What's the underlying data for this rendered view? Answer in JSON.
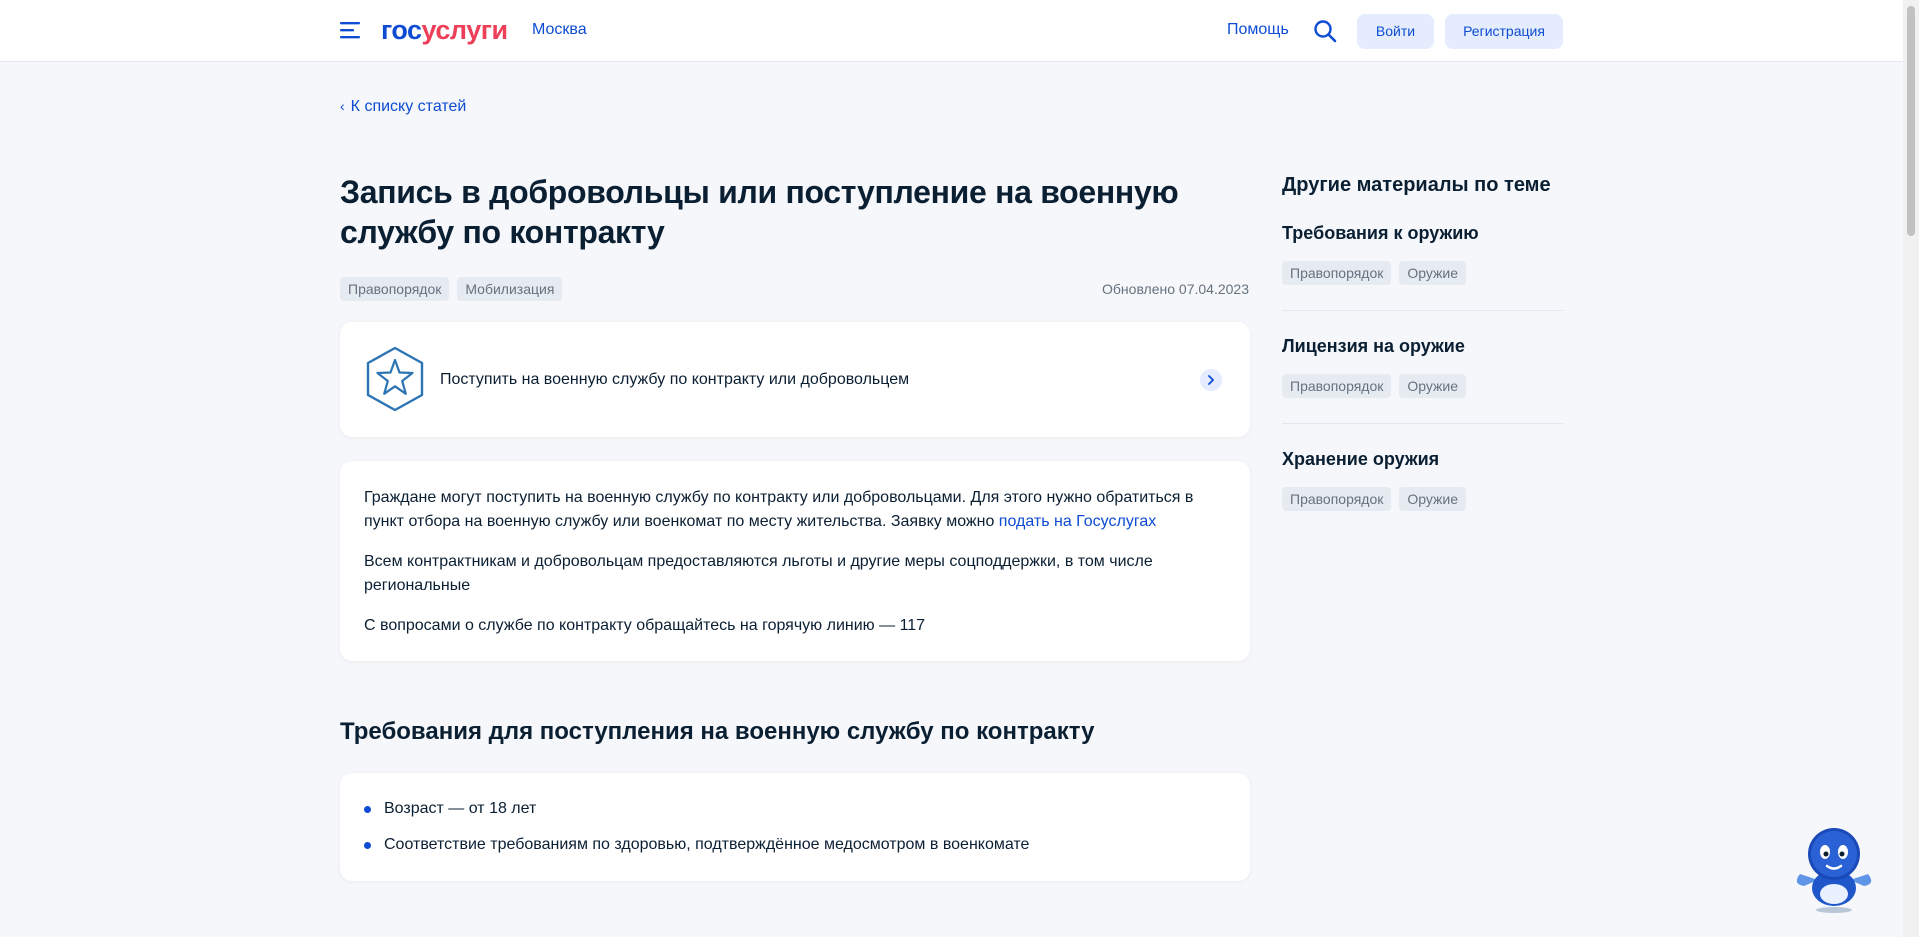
{
  "header": {
    "logo_part1": "гос",
    "logo_part2": "услуги",
    "city": "Москва",
    "help": "Помощь",
    "login": "Войти",
    "register": "Регистрация"
  },
  "back_link": "К списку статей",
  "article": {
    "title": "Запись в добровольцы или поступление на военную службу по контракту",
    "tags": [
      "Правопорядок",
      "Мобилизация"
    ],
    "updated": "Обновлено 07.04.2023",
    "service_card": {
      "text": "Поступить на военную службу по контракту или добровольцем",
      "icon": "star-hexagon-icon"
    },
    "info": {
      "p1_text": "Граждане могут поступить на военную службу по контракту или добровольцами. Для этого нужно обратиться в пункт отбора на военную службу или военкомат по месту жительства. Заявку можно ",
      "p1_link": "подать на Госуслугах",
      "p2": "Всем контрактникам и добровольцам предоставляются льготы и другие меры соцподдержки, в том числе региональные",
      "p3": "С вопросами о службе по контракту обращайтесь на горячую линию — 117"
    },
    "requirements": {
      "title": "Требования для поступления на военную службу по контракту",
      "items": [
        "Возраст — от 18 лет",
        "Соответствие требованиям по здоровью, подтверждённое медосмотром в военкомате"
      ]
    }
  },
  "sidebar": {
    "title": "Другие материалы по теме",
    "items": [
      {
        "name": "Требования к оружию",
        "tags": [
          "Правопорядок",
          "Оружие"
        ]
      },
      {
        "name": "Лицензия на оружие",
        "tags": [
          "Правопорядок",
          "Оружие"
        ]
      },
      {
        "name": "Хранение оружия",
        "tags": [
          "Правопорядок",
          "Оружие"
        ]
      }
    ]
  },
  "colors": {
    "brand_blue": "#0d4cd3",
    "brand_red": "#ee3f58",
    "background": "#f5f7fa",
    "tag_bg": "#e6ebf1"
  }
}
